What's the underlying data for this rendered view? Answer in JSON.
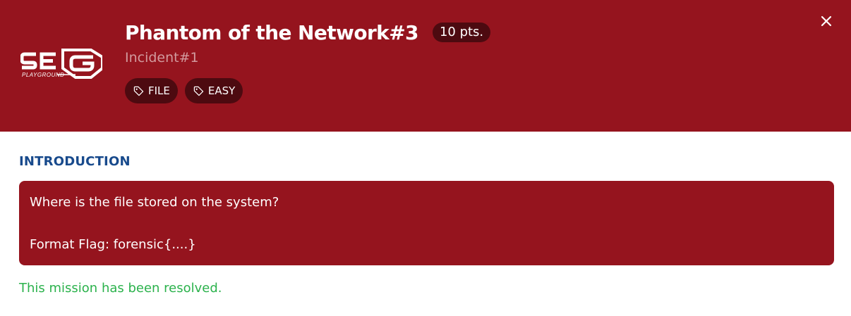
{
  "header": {
    "logo_text": "SEG PLAYGROUND",
    "title": "Phantom of the Network#3",
    "points": "10 pts.",
    "subtitle": "Incident#1",
    "tags": [
      {
        "label": "FILE",
        "icon": "tag-icon"
      },
      {
        "label": "EASY",
        "icon": "tag-icon"
      }
    ],
    "close_icon": "close-icon"
  },
  "body": {
    "section_title": "INTRODUCTION",
    "question": "Where is the file stored on the system?",
    "format": "Format Flag: forensic{....}",
    "status": "This mission has been resolved."
  },
  "colors": {
    "header_bg": "#95141e",
    "badge_bg": "#4d0a10",
    "section_title": "#184a8c",
    "status_green": "#2bb24c"
  }
}
